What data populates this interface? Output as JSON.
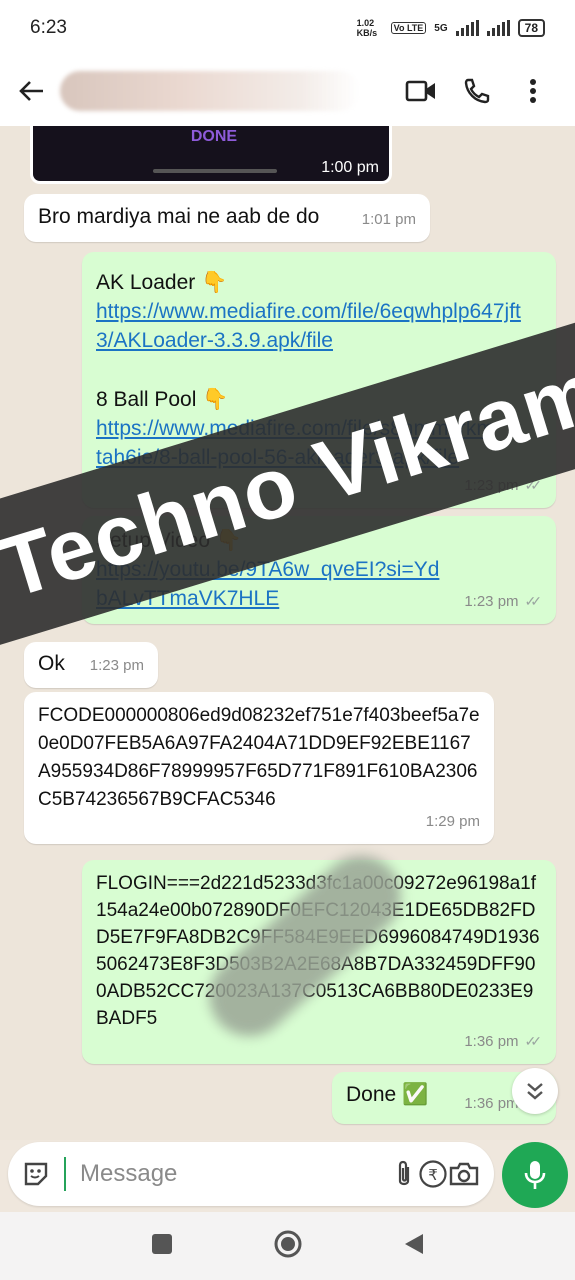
{
  "status_bar": {
    "time": "6:23",
    "network_speed": "1.02 KB/s",
    "volte": "Vo LTE",
    "network_type": "5G",
    "battery": "78"
  },
  "app_bar": {
    "contact_name": ""
  },
  "messages": [
    {
      "id": "video",
      "direction": "in",
      "done_label": "DONE",
      "time": "1:00 pm"
    },
    {
      "id": "m1",
      "direction": "in",
      "text": "Bro mardiya mai ne aab de do",
      "time": "1:01 pm"
    },
    {
      "id": "m2",
      "direction": "out",
      "title1": "AK Loader 👇",
      "link1": "https://www.mediafire.com/file/6eqwhplp647jft3/AKLoader-3.3.9.apk/file",
      "title2": "8 Ball Pool 👇",
      "link2": "https://www.mediafire.com/file/s8hmmzrkmtah6ie/8-ball-pool-56-akloader3.apk/file",
      "time": "1:23 pm"
    },
    {
      "id": "m3",
      "direction": "out",
      "title": "Setup Video 👇",
      "link": "https://youtu.be/9TA6w_qveEI?si=YdbALvTTmaVK7HLE",
      "time": "1:23 pm"
    },
    {
      "id": "m4",
      "direction": "in",
      "text": "Ok",
      "time": "1:23 pm"
    },
    {
      "id": "m5",
      "direction": "in",
      "text": "FCODE000000806ed9d08232ef751e7f403beef5a7e0e0D07FEB5A6A97FA2404A71DD9EF92EBE1167A955934D86F78999957F65D771F891F610BA2306C5B74236567B9CFAC5346",
      "time": "1:29 pm"
    },
    {
      "id": "m6",
      "direction": "out",
      "text": "FLOGIN===2d221d5233d3fc1a00c09272e96198a1f154a24e00b072890DF0EFC12043E1DE65DB82FDD5E7F9FA8DB2C9FF584E9EED6996084749D19365062473E8F3D503B2A2E68A8B7DA332459DFF900ADB52CC720023A137C0513CA6BB80DE0233E9BADF5",
      "time": "1:36 pm"
    },
    {
      "id": "m7",
      "direction": "out",
      "text": "Done ✅",
      "time": "1:36 pm"
    }
  ],
  "watermark": "Techno Vikram",
  "composer": {
    "placeholder": "Message"
  },
  "colors": {
    "outgoing_bubble": "#d8fdd2",
    "incoming_bubble": "#ffffff",
    "link": "#1b73c4",
    "mic_button": "#1fa855",
    "chat_background": "#ede5da"
  },
  "icons": [
    "back-arrow-icon",
    "video-call-icon",
    "phone-icon",
    "more-vert-icon",
    "sticker-icon",
    "attach-icon",
    "rupee-icon",
    "camera-icon",
    "mic-icon",
    "double-chevron-down-icon",
    "nav-square-icon",
    "nav-circle-icon",
    "nav-back-icon"
  ]
}
